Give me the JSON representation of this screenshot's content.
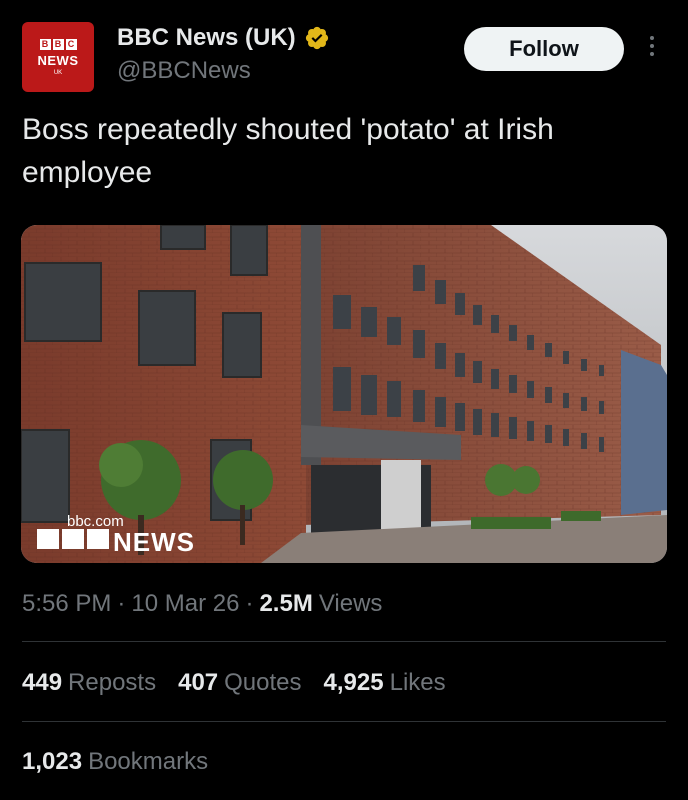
{
  "account": {
    "avatar": {
      "letters": [
        "B",
        "B",
        "C"
      ],
      "word": "NEWS",
      "sub": "UK"
    },
    "name": "BBC News (UK)",
    "handle": "@BBCNews",
    "verified_icon": "verified-badge-gold"
  },
  "follow_label": "Follow",
  "tweet": {
    "text": "Boss repeatedly shouted 'potato' at Irish employee"
  },
  "media": {
    "watermark_url": "bbc.com",
    "watermark_news": "NEWS"
  },
  "meta": {
    "time": "5:56 PM",
    "sep1": "·",
    "date": "10 Mar 26",
    "sep2": "·",
    "views_count": "2.5M",
    "views_label": "Views"
  },
  "stats": [
    {
      "count": "449",
      "label": "Reposts"
    },
    {
      "count": "407",
      "label": "Quotes"
    },
    {
      "count": "4,925",
      "label": "Likes"
    }
  ],
  "bookmarks": {
    "count": "1,023",
    "label": "Bookmarks"
  },
  "colors": {
    "background": "#000000",
    "text": "#e7e9ea",
    "muted": "#71767b",
    "bbc_red": "#bb1919",
    "verified": "#e2b719"
  }
}
